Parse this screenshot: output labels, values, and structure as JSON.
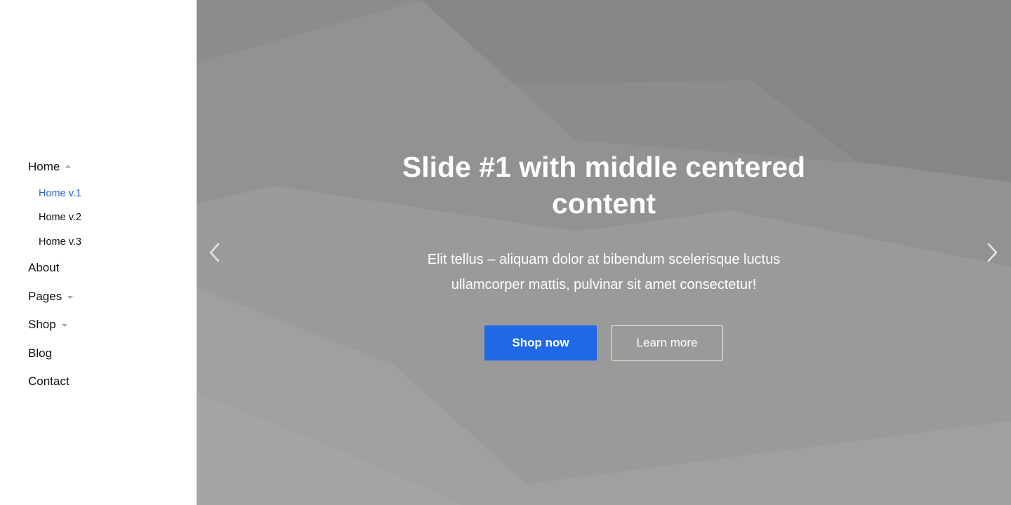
{
  "sidebar": {
    "items": [
      {
        "label": "Home",
        "caret": "up",
        "children": [
          {
            "label": "Home v.1",
            "active": true
          },
          {
            "label": "Home v.2",
            "active": false
          },
          {
            "label": "Home v.3",
            "active": false
          }
        ]
      },
      {
        "label": "About"
      },
      {
        "label": "Pages",
        "caret": "down"
      },
      {
        "label": "Shop",
        "caret": "down"
      },
      {
        "label": "Blog"
      },
      {
        "label": "Contact"
      }
    ]
  },
  "hero": {
    "title": "Slide #1 with middle centered content",
    "text": "Elit tellus – aliquam dolor at bibendum scelerisque luctus ullamcorper mattis, pulvinar sit amet consectetur!",
    "primary_button": "Shop now",
    "secondary_button": "Learn more",
    "prev_icon": "chevron-left-icon",
    "next_icon": "chevron-right-icon"
  },
  "colors": {
    "accent": "#1f69e6",
    "active_link": "#2a67c9",
    "hero_bg": "#8f8f8f"
  }
}
